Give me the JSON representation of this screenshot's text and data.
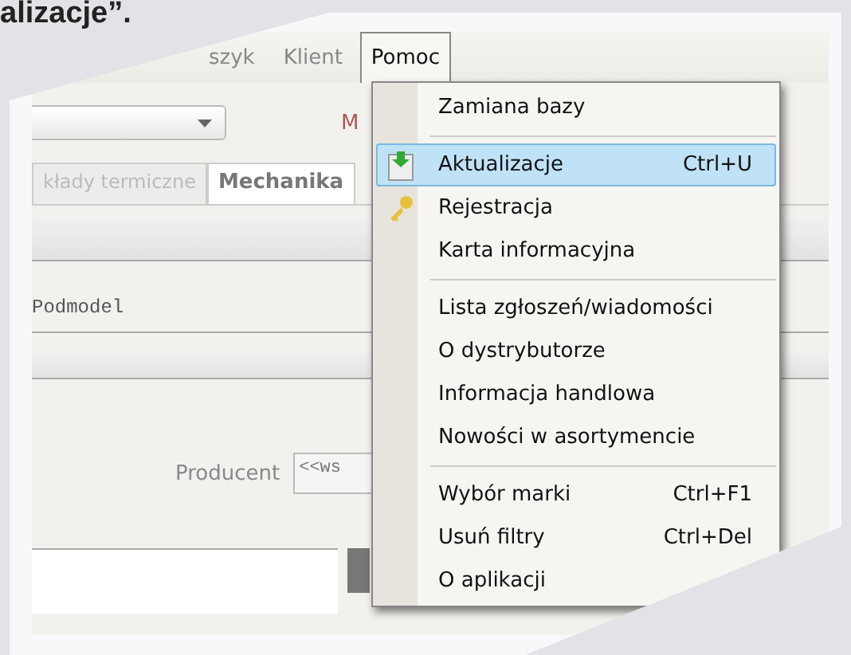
{
  "caption": "alizacje”.",
  "menubar": [
    {
      "label": "szyk",
      "selected": false
    },
    {
      "label": "Klient",
      "selected": false
    },
    {
      "label": "Pomoc",
      "selected": true
    }
  ],
  "toolbar": {
    "label": "M"
  },
  "tabs": [
    {
      "label": "kłady termiczne",
      "selected": false
    },
    {
      "label": "Mechanika",
      "selected": true
    }
  ],
  "form": {
    "podmodel_label": "Podmodel",
    "producent_label": "Producent",
    "producent_value": "<<ws"
  },
  "menu": {
    "groups": [
      [
        {
          "label": "Zamiana bazy",
          "kind": "plain",
          "selected": false
        }
      ],
      [
        {
          "label": "Aktualizacje",
          "shortcut": "Ctrl+U",
          "kind": "download",
          "selected": true
        },
        {
          "label": "Rejestracja",
          "kind": "key",
          "selected": false
        },
        {
          "label": "Karta informacyjna",
          "kind": "plain",
          "selected": false
        }
      ],
      [
        {
          "label": "Lista zgłoszeń/wiadomości",
          "kind": "plain",
          "selected": false
        },
        {
          "label": "O dystrybutorze",
          "kind": "plain",
          "selected": false
        },
        {
          "label": "Informacja handlowa",
          "kind": "plain",
          "selected": false
        },
        {
          "label": "Nowości w asortymencie",
          "kind": "plain",
          "selected": false
        }
      ],
      [
        {
          "label": "Wybór marki",
          "shortcut": "Ctrl+F1",
          "kind": "plain",
          "selected": false
        },
        {
          "label": "Usuń filtry",
          "shortcut": "Ctrl+Del",
          "kind": "plain",
          "selected": false
        },
        {
          "label": "O aplikacji",
          "kind": "plain",
          "selected": false
        }
      ]
    ]
  }
}
